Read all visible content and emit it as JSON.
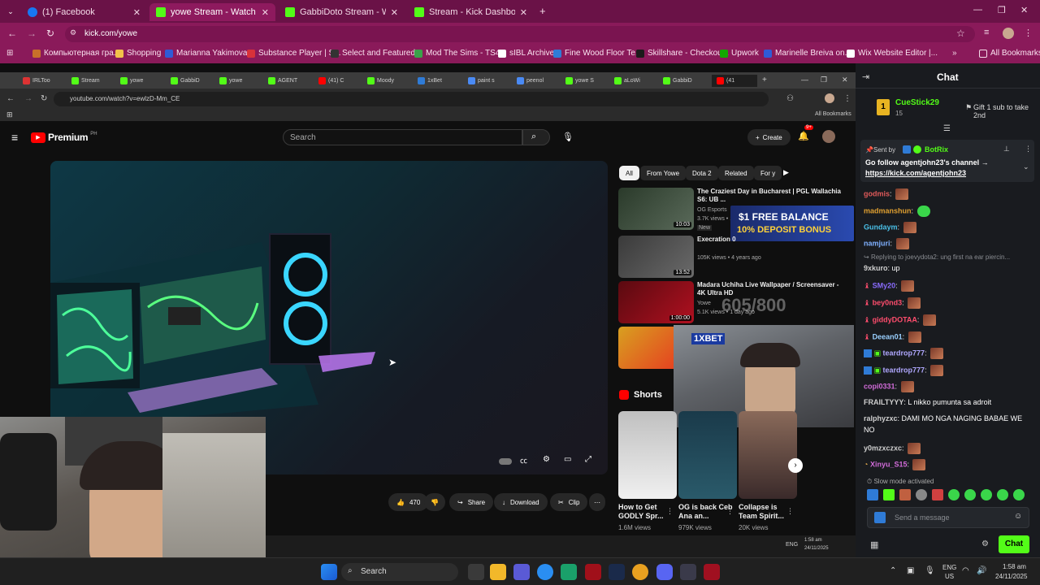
{
  "outer_browser": {
    "tabs": [
      {
        "label": "(1) Facebook",
        "color": "#1877f2"
      },
      {
        "label": "yowe Stream - Watch Live on K",
        "color": "#53fc18"
      },
      {
        "label": "GabbiDoto Stream - Watch Live",
        "color": "#53fc18"
      },
      {
        "label": "Stream - Kick Dashboard",
        "color": "#53fc18"
      }
    ],
    "url": "kick.com/yowe",
    "bookmarks": [
      "Компьютерная гра...",
      "Shopping",
      "Marianna Yakimova...",
      "Substance Player | S...",
      "Select and Featured...",
      "Mod The Sims - TS4...",
      "sIBL Archive",
      "Fine Wood Floor Te...",
      "Skillshare - Checkou...",
      "Upwork",
      "Marinelle Breiva on...",
      "Wix Website Editor |..."
    ],
    "all_bookmarks": "All Bookmarks"
  },
  "inner_browser": {
    "tabs": [
      "IRLToo",
      "Stream",
      "yowe",
      "GabbiD",
      "yowe",
      "AGENT",
      "(41) C",
      "Moody",
      "1xBet",
      "paint s",
      "peenol",
      "yowe S",
      "aLoWi",
      "GabbiD",
      "(41"
    ],
    "url": "youtube.com/watch?v=ewlzD-Mm_CE",
    "all_bookmarks": "All Bookmarks"
  },
  "youtube": {
    "logo": "Premium",
    "logo_sup": "PH",
    "search_placeholder": "Search",
    "create_label": "Create",
    "notif_count": "9+",
    "chips": [
      "All",
      "From Yowe",
      "Dota 2",
      "Related",
      "For y"
    ],
    "recommendations": [
      {
        "title": "The Craziest Day in Bucharest | PGL Wallachia S6: UB ...",
        "channel": "OG Esports",
        "meta": "3.7K views • 17 hours ago",
        "badge": "New",
        "duration": "10:03"
      },
      {
        "title": "Execration 0",
        "channel": "",
        "meta": "105K views • 4 years ago",
        "badge": "",
        "duration": "13:52"
      },
      {
        "title": "Madara Uchiha Live Wallpaper / Screensaver - 4K Ultra HD",
        "channel": "Yowe",
        "meta": "5.1K views • 1 day ago",
        "badge": "",
        "duration": "1:00:00"
      },
      {
        "title": "",
        "channel": "",
        "meta": "",
        "badge": "",
        "duration": ""
      }
    ],
    "ad_text_1": "$1 FREE BALANCE",
    "ad_text_2": "10% DEPOSIT BONUS",
    "overlay_counter": "605/800",
    "ad_brand": "1XBET",
    "shorts_label": "Shorts",
    "shorts": [
      {
        "title": "How to Get GODLY Spr...",
        "views": "1.6M views"
      },
      {
        "title": "OG is back Ceb Ana an...",
        "views": "979K views"
      },
      {
        "title": "Collapse is Team Spirit...",
        "views": "20K views"
      }
    ],
    "like_count": "470",
    "share_label": "Share",
    "download_label": "Download",
    "clip_label": "Clip"
  },
  "chat": {
    "title": "Chat",
    "top_gifter": {
      "name": "CueStick29",
      "count": "15",
      "text": "Gift 1 sub to take 2nd"
    },
    "pinned": {
      "sent_by": "Sent by",
      "bot": "BotRix",
      "text": "Go follow agentjohn23's channel →",
      "link": "https://kick.com/agentjohn23"
    },
    "messages": [
      {
        "user": "godmis",
        "text": "",
        "color": "#e05a5a",
        "emote": true
      },
      {
        "user": "madmanshun",
        "text": "",
        "color": "#e0a030",
        "emote": true
      },
      {
        "user": "Gundaym",
        "text": "",
        "color": "#4ac0e8",
        "emote": true
      },
      {
        "user": "namjuri",
        "text": "",
        "color": "#7fb0ff",
        "emote": true
      },
      {
        "user": "9xkuro",
        "text": "up",
        "color": "#cfcfcf",
        "emote": false
      },
      {
        "user": "SMy20",
        "text": "",
        "color": "#8a6cff",
        "emote": true
      },
      {
        "user": "bey0nd3",
        "text": "",
        "color": "#ff4d6d",
        "emote": true
      },
      {
        "user": "giddyDOTAA",
        "text": "",
        "color": "#ff4d6d",
        "emote": true
      },
      {
        "user": "Deean01",
        "text": "",
        "color": "#9ad0ff",
        "emote": true
      },
      {
        "user": "teardrop777",
        "text": "",
        "color": "#b0a8ff",
        "emote": true
      },
      {
        "user": "teardrop777",
        "text": "",
        "color": "#b0a8ff",
        "emote": true
      },
      {
        "user": "copi0331",
        "text": "",
        "color": "#d06bd8",
        "emote": true
      },
      {
        "user": "FRAILTYYY",
        "text": "L nikko pumunta sa adroit",
        "color": "#cfcfcf",
        "emote": false
      },
      {
        "user": "ralphyzxc",
        "text": "DAMI MO NGA NAGING BABAE WE",
        "color": "#cfcfcf",
        "emote": false
      },
      {
        "user": "y0mzxczxc",
        "text": "",
        "color": "#cfcfcf",
        "emote": true
      },
      {
        "user": "Xinyu_S15",
        "text": "",
        "color": "#d06bd8",
        "emote": true
      }
    ],
    "reply_text": "Replying to joevydota2: ung first na ear piercin...",
    "continuation": "NO",
    "slow_mode": "Slow mode activated",
    "input_placeholder": "Send a message",
    "chat_button": "Chat"
  },
  "taskbar": {
    "search": "Search",
    "lang_1": "ENG",
    "lang_2": "US",
    "time": "1:58 am",
    "date": "24/11/2025"
  }
}
